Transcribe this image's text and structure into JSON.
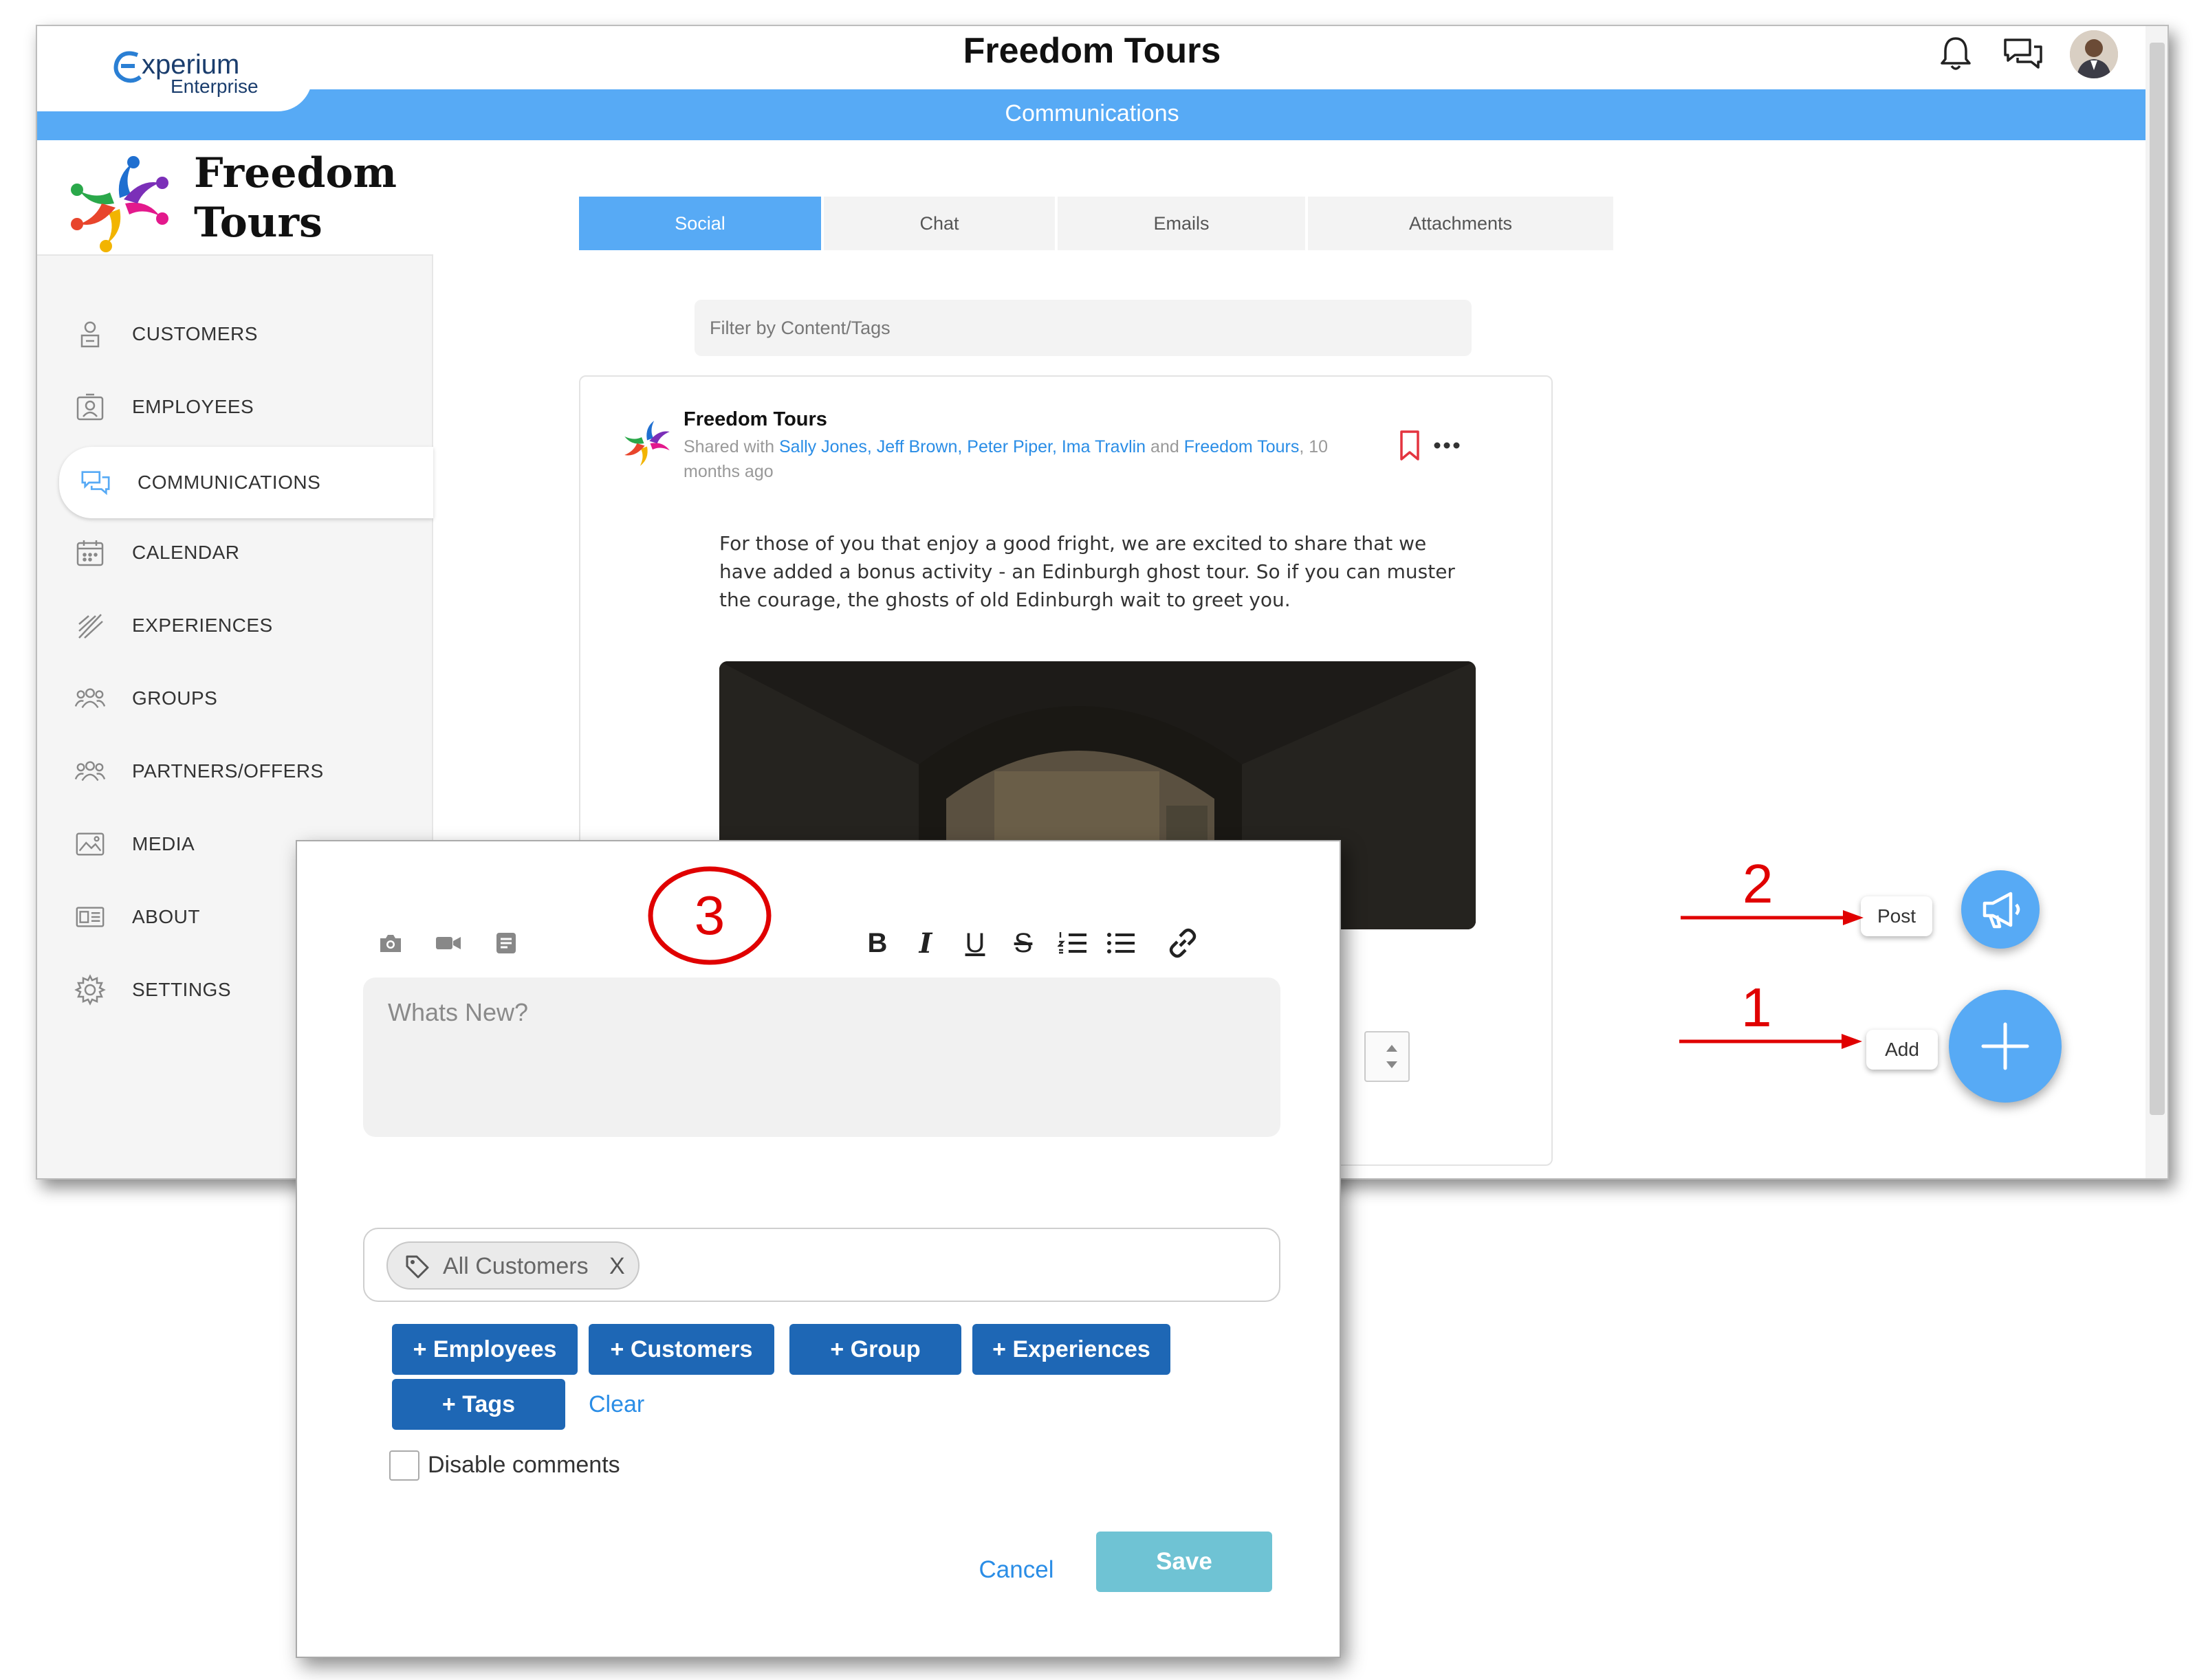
{
  "header": {
    "logo_main": "xperium",
    "logo_sub": "Enterprise",
    "title": "Freedom Tours",
    "section": "Communications"
  },
  "brand": {
    "line1": "Freedom",
    "line2": "Tours"
  },
  "sidebar": {
    "items": [
      {
        "label": "CUSTOMERS"
      },
      {
        "label": "EMPLOYEES"
      },
      {
        "label": "COMMUNICATIONS"
      },
      {
        "label": "CALENDAR"
      },
      {
        "label": "EXPERIENCES"
      },
      {
        "label": "GROUPS"
      },
      {
        "label": "PARTNERS/OFFERS"
      },
      {
        "label": "MEDIA"
      },
      {
        "label": "ABOUT"
      },
      {
        "label": "SETTINGS"
      }
    ]
  },
  "tabs": [
    {
      "label": "Social"
    },
    {
      "label": "Chat"
    },
    {
      "label": "Emails"
    },
    {
      "label": "Attachments"
    }
  ],
  "filter": {
    "placeholder": "Filter by Content/Tags"
  },
  "post": {
    "author": "Freedom Tours",
    "shared_prefix": "Shared with",
    "shared_names": "Sally Jones, Jeff Brown, Peter Piper, Ima Travlin",
    "shared_and": "and",
    "shared_last": "Freedom Tours",
    "time_1": ", 10",
    "time_2": "months ago",
    "body": "For those of you that enjoy a good fright, we are excited to share that we have added a bonus activity - an Edinburgh ghost tour. So if you can muster the courage, the ghosts of old Edinburgh wait to greet you."
  },
  "fab": {
    "post_label": "Post",
    "add_label": "Add"
  },
  "annotations": {
    "one": "1",
    "two": "2",
    "three": "3"
  },
  "modal": {
    "editor_placeholder": "Whats New?",
    "tag_chip": "All Customers",
    "tag_remove": "X",
    "buttons": [
      "+ Employees",
      "+ Customers",
      "+ Group",
      "+ Experiences",
      "+ Tags"
    ],
    "clear": "Clear",
    "disable_comments": "Disable comments",
    "cancel": "Cancel",
    "save": "Save"
  },
  "colors": {
    "accent": "#57aaf5",
    "button_blue": "#1e67b5",
    "annotation_red": "#e00000",
    "save_disabled": "#6fc3d4"
  }
}
